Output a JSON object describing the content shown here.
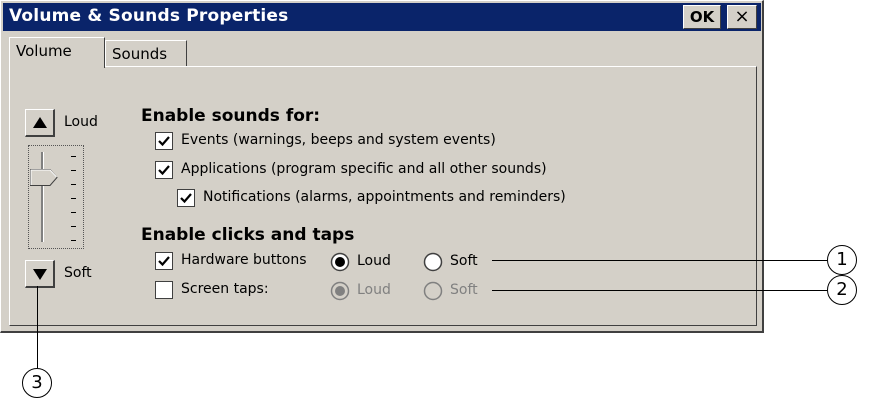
{
  "window": {
    "title": "Volume & Sounds Properties",
    "ok_label": "OK",
    "close_label": "×"
  },
  "tabs": [
    {
      "label": "Volume",
      "active": true
    },
    {
      "label": "Sounds",
      "active": false
    }
  ],
  "volume": {
    "loud_label": "Loud",
    "soft_label": "Soft",
    "slider_level": 0.75
  },
  "enable_sounds": {
    "heading": "Enable sounds for:",
    "events": {
      "label": "Events (warnings, beeps and system events)",
      "checked": true
    },
    "applications": {
      "label": "Applications (program specific and all other sounds)",
      "checked": true
    },
    "notifications": {
      "label": "Notifications (alarms, appointments and reminders)",
      "checked": true
    }
  },
  "enable_clicks": {
    "heading": "Enable clicks and taps",
    "hardware_buttons": {
      "label": "Hardware buttons",
      "checked": true,
      "loud": "Loud",
      "soft": "Soft",
      "selected": "Loud"
    },
    "screen_taps": {
      "label": "Screen taps:",
      "checked": false,
      "loud": "Loud",
      "soft": "Soft",
      "selected": "Loud",
      "enabled": false
    }
  },
  "callouts": [
    "1",
    "2",
    "3"
  ],
  "colors": {
    "titlebar": "#0a246a",
    "face": "#d4d0c8",
    "disabled_text": "#808080"
  }
}
